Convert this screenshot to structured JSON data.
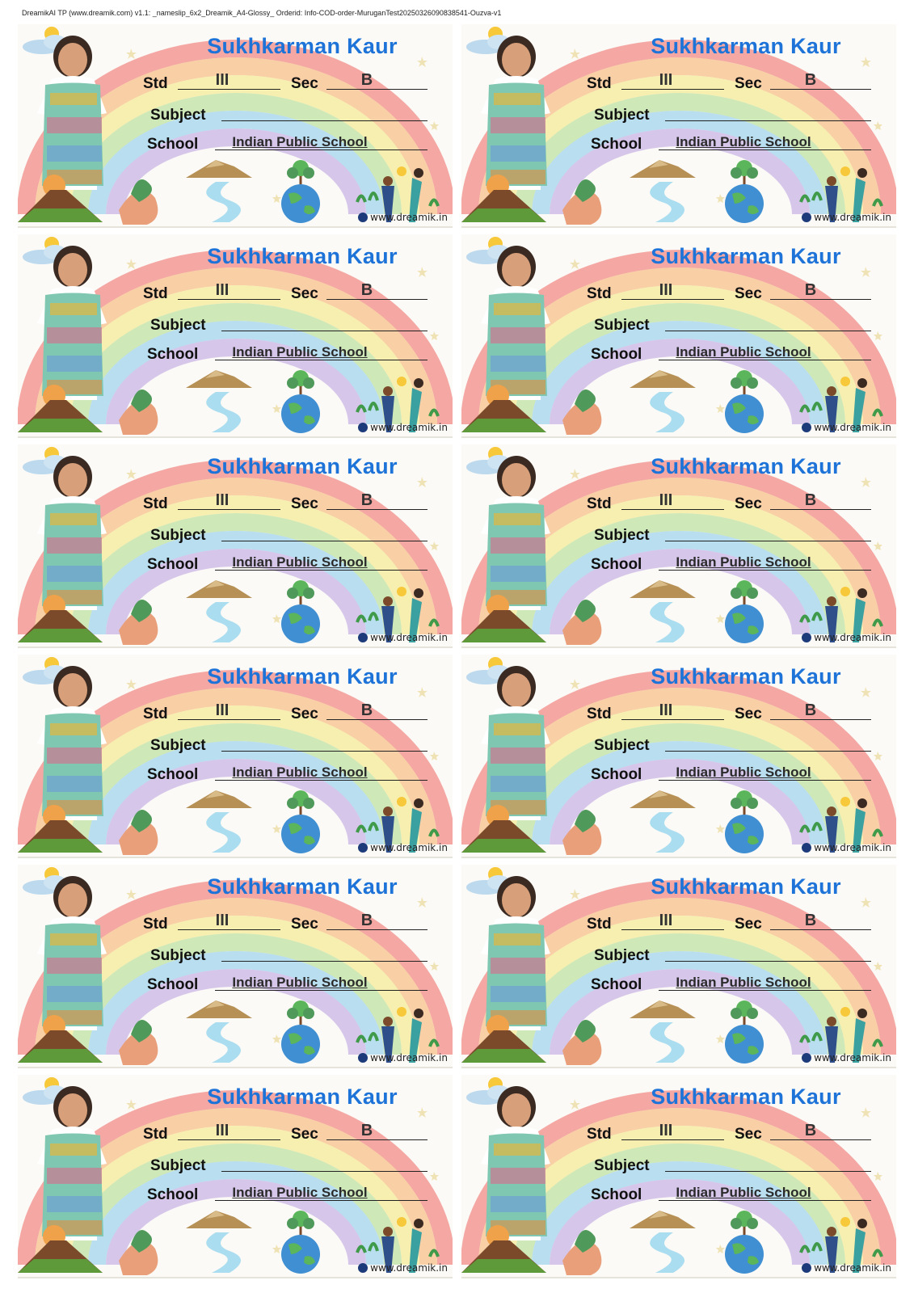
{
  "header": "DreamikAI TP (www.dreamik.com) v1.1: _nameslip_6x2_Dreamik_A4-Glossy_ Orderid: Info-COD-order-MuruganTest20250326090838541-Ouzva-v1",
  "slip": {
    "name": "Sukhkarman Kaur",
    "std_label": "Std",
    "std_value": "III",
    "sec_label": "Sec",
    "sec_value": "B",
    "subject_label": "Subject",
    "subject_value": "",
    "school_label": "School",
    "school_value": "Indian Public School",
    "url": "www.dreamik.in"
  },
  "colors": {
    "name": "#1e73d8",
    "rainbow": [
      "#f4a7a3",
      "#f9cfa6",
      "#f7efb0",
      "#cfe8b8",
      "#b9def0",
      "#d6c7ea"
    ]
  },
  "icons": [
    "girl-photo",
    "sun-cloud-icon",
    "volcano-icon",
    "mountain-icon",
    "river-icon",
    "earth-tree-icon",
    "plant-hands-icon",
    "gardeners-icon",
    "dreamik-logo-icon"
  ],
  "layout_grid": {
    "rows": 6,
    "columns": 2
  }
}
